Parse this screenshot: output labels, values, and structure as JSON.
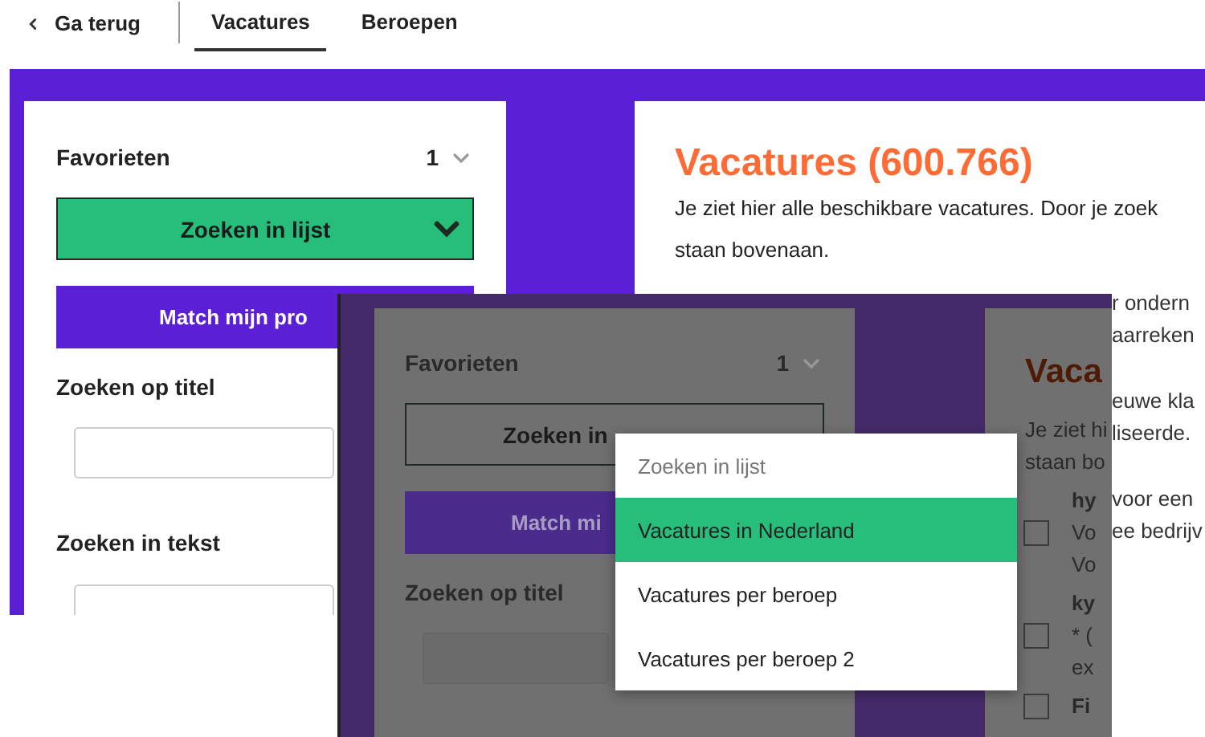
{
  "nav": {
    "back_label": "Ga terug",
    "tabs": [
      {
        "label": "Vacatures",
        "selected": true
      },
      {
        "label": "Beroepen",
        "selected": false
      }
    ]
  },
  "sidebar": {
    "favorites_label": "Favorieten",
    "favorites_count": "1",
    "list_select": "Zoeken in lijst",
    "match_button": "Match mijn pro",
    "fields": [
      {
        "label": "Zoeken op titel"
      },
      {
        "label": "Zoeken in tekst"
      }
    ]
  },
  "content": {
    "title": "Vacatures (600.766)",
    "intro_lines": [
      "Je ziet hier alle beschikbare vacatures. Door je zoek",
      "staan bovenaan."
    ],
    "fragment_blocks": [
      [
        "r ondern",
        "aarreken"
      ],
      [
        "euwe kla",
        "liseerde."
      ],
      [
        "voor een",
        "ee bedrijv"
      ]
    ]
  },
  "inset": {
    "sidebar": {
      "favorites_label": "Favorieten",
      "favorites_count": "1",
      "list_select": "Zoeken in",
      "match_button": "Match mi",
      "fields": [
        {
          "label": "Zoeken op titel"
        }
      ]
    },
    "content": {
      "title": "Vaca",
      "intro_lines": [
        "Je ziet hi",
        "staan bo"
      ],
      "results": [
        {
          "title": "hy",
          "lines": [
            "Vo",
            "Vo"
          ],
          "checked": false
        },
        {
          "title": "ky",
          "lines": [
            "* (",
            "ex"
          ],
          "checked": false
        },
        {
          "title": "Fi",
          "checked": false
        }
      ]
    },
    "menu": {
      "options": [
        {
          "label": "Zoeken in lijst",
          "kind": "placeholder",
          "selected": false
        },
        {
          "label": "Vacatures in Nederland",
          "kind": "option",
          "selected": true
        },
        {
          "label": "Vacatures per beroep",
          "kind": "option",
          "selected": false
        },
        {
          "label": "Vacatures per beroep 2",
          "kind": "option",
          "selected": false
        }
      ]
    }
  }
}
